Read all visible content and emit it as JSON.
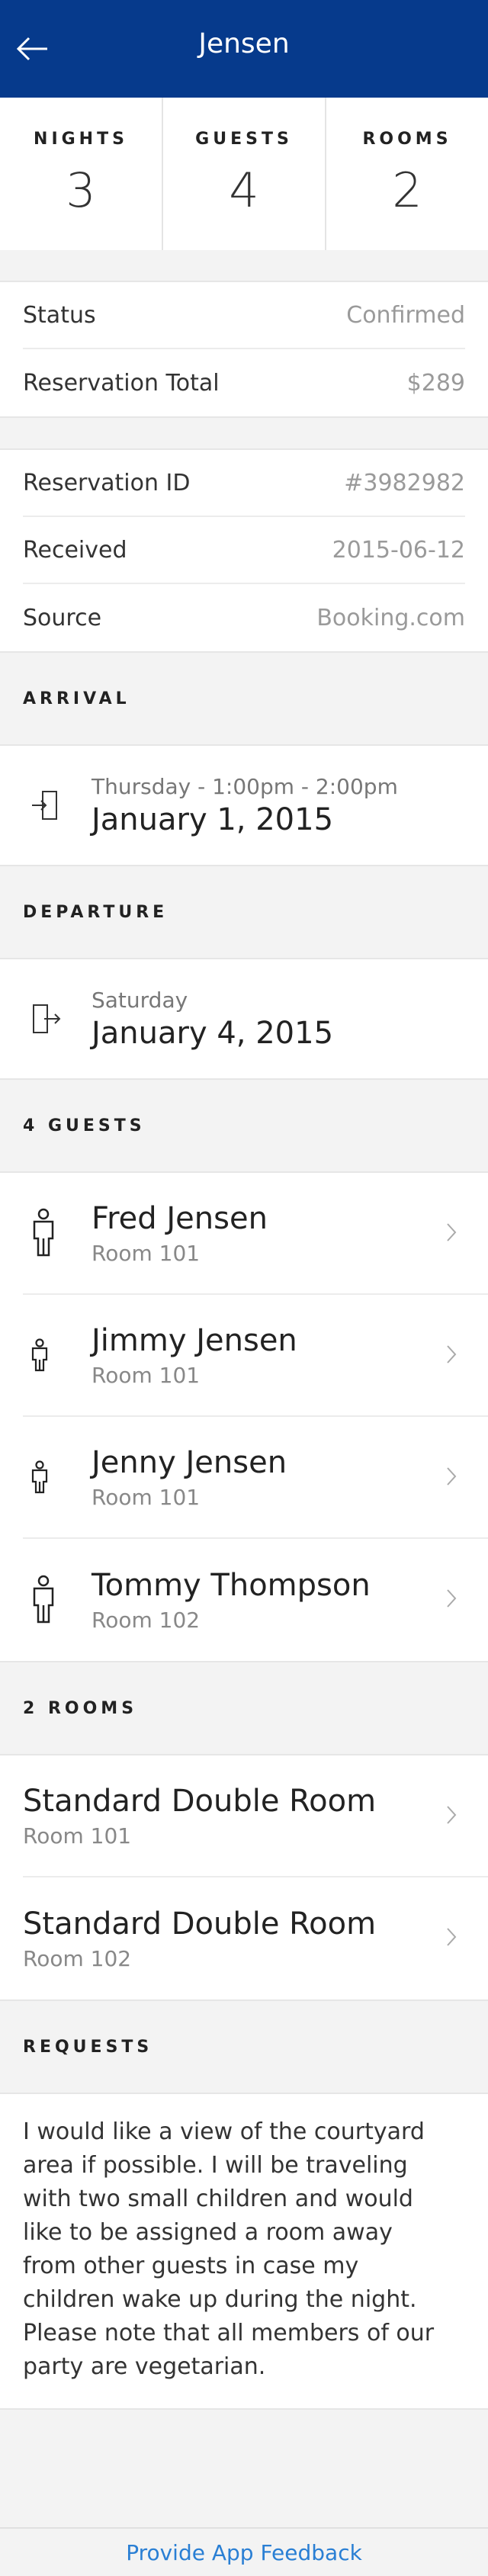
{
  "header": {
    "title": "Jensen"
  },
  "stats": [
    {
      "label": "NIGHTS",
      "value": "3"
    },
    {
      "label": "GUESTS",
      "value": "4"
    },
    {
      "label": "ROOMS",
      "value": "2"
    }
  ],
  "summary": [
    {
      "label": "Status",
      "value": "Confirmed"
    },
    {
      "label": "Reservation Total",
      "value": "$289"
    }
  ],
  "details": [
    {
      "label": "Reservation ID",
      "value": "#3982982"
    },
    {
      "label": "Received",
      "value": "2015-06-12"
    },
    {
      "label": "Source",
      "value": "Booking.com"
    }
  ],
  "arrival": {
    "title": "ARRIVAL",
    "sub": "Thursday - 1:00pm - 2:00pm",
    "date": "January 1, 2015",
    "icon": "door-enter-icon"
  },
  "departure": {
    "title": "DEPARTURE",
    "sub": "Saturday",
    "date": "January 4, 2015",
    "icon": "door-exit-icon"
  },
  "guests": {
    "title": "4 GUESTS",
    "items": [
      {
        "name": "Fred Jensen",
        "room": "Room 101",
        "icon": "adult-person-icon"
      },
      {
        "name": "Jimmy Jensen",
        "room": "Room 101",
        "icon": "child-person-icon"
      },
      {
        "name": "Jenny Jensen",
        "room": "Room 101",
        "icon": "child-person-icon"
      },
      {
        "name": "Tommy Thompson",
        "room": "Room 102",
        "icon": "adult-person-icon"
      }
    ]
  },
  "rooms": {
    "title": "2 ROOMS",
    "items": [
      {
        "name": "Standard Double Room",
        "room": "Room 101"
      },
      {
        "name": "Standard Double Room",
        "room": "Room 102"
      }
    ]
  },
  "requests": {
    "title": "REQUESTS",
    "text": "I would like a view of the courtyard area if possible. I will be traveling with two small children and would like to be assigned a room away from other guests in case my children wake up during the night. Please note that all members of our party are vegetarian."
  },
  "footer": {
    "link": "Provide App Feedback"
  },
  "colors": {
    "header": "#063a8c",
    "link": "#2a7fd4"
  }
}
